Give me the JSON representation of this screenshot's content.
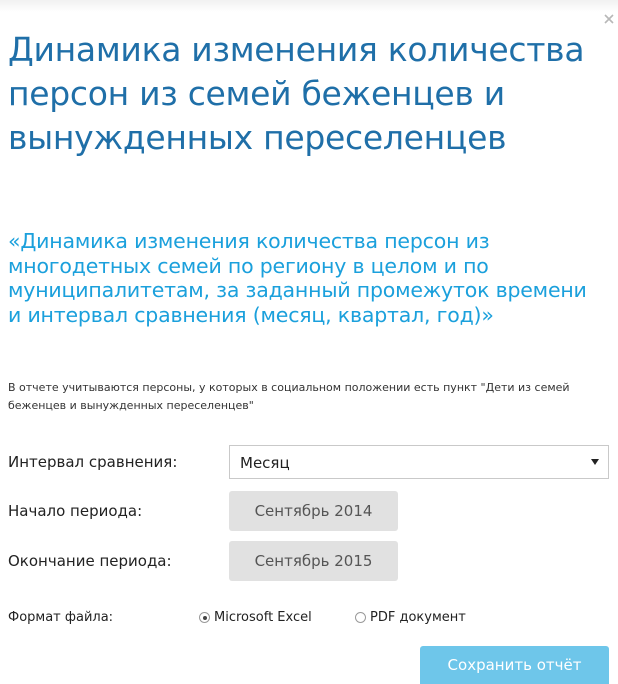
{
  "dialog": {
    "title": "Динамика изменения количества персон из семей беженцев и вынужденных переселенцев",
    "subtitle": "«Динамика изменения количества персон из многодетных семей по региону в целом и по муниципалитетам, за заданный промежуток времени и интервал сравнения (месяц, квартал, год)»",
    "note": "В отчете учитываются персоны, у которых в социальном положении есть пункт \"Дети из семей беженцев и вынужденных переселенцев\"",
    "close_icon": "close-icon"
  },
  "form": {
    "interval_label": "Интервал сравнения:",
    "interval_value": "Месяц",
    "start_label": "Начало периода:",
    "start_value": "Сентябрь 2014",
    "end_label": "Окончание периода:",
    "end_value": "Сентябрь 2015",
    "format_label": "Формат файла:",
    "format_options": [
      {
        "label": "Microsoft Excel",
        "checked": true
      },
      {
        "label": "PDF документ",
        "checked": false
      }
    ]
  },
  "actions": {
    "save_label": "Сохранить отчёт"
  },
  "colors": {
    "title": "#1f6fa8",
    "subtitle": "#1ba0dc",
    "save_button": "#6ec6ea",
    "date_button": "#e1e1e1"
  }
}
